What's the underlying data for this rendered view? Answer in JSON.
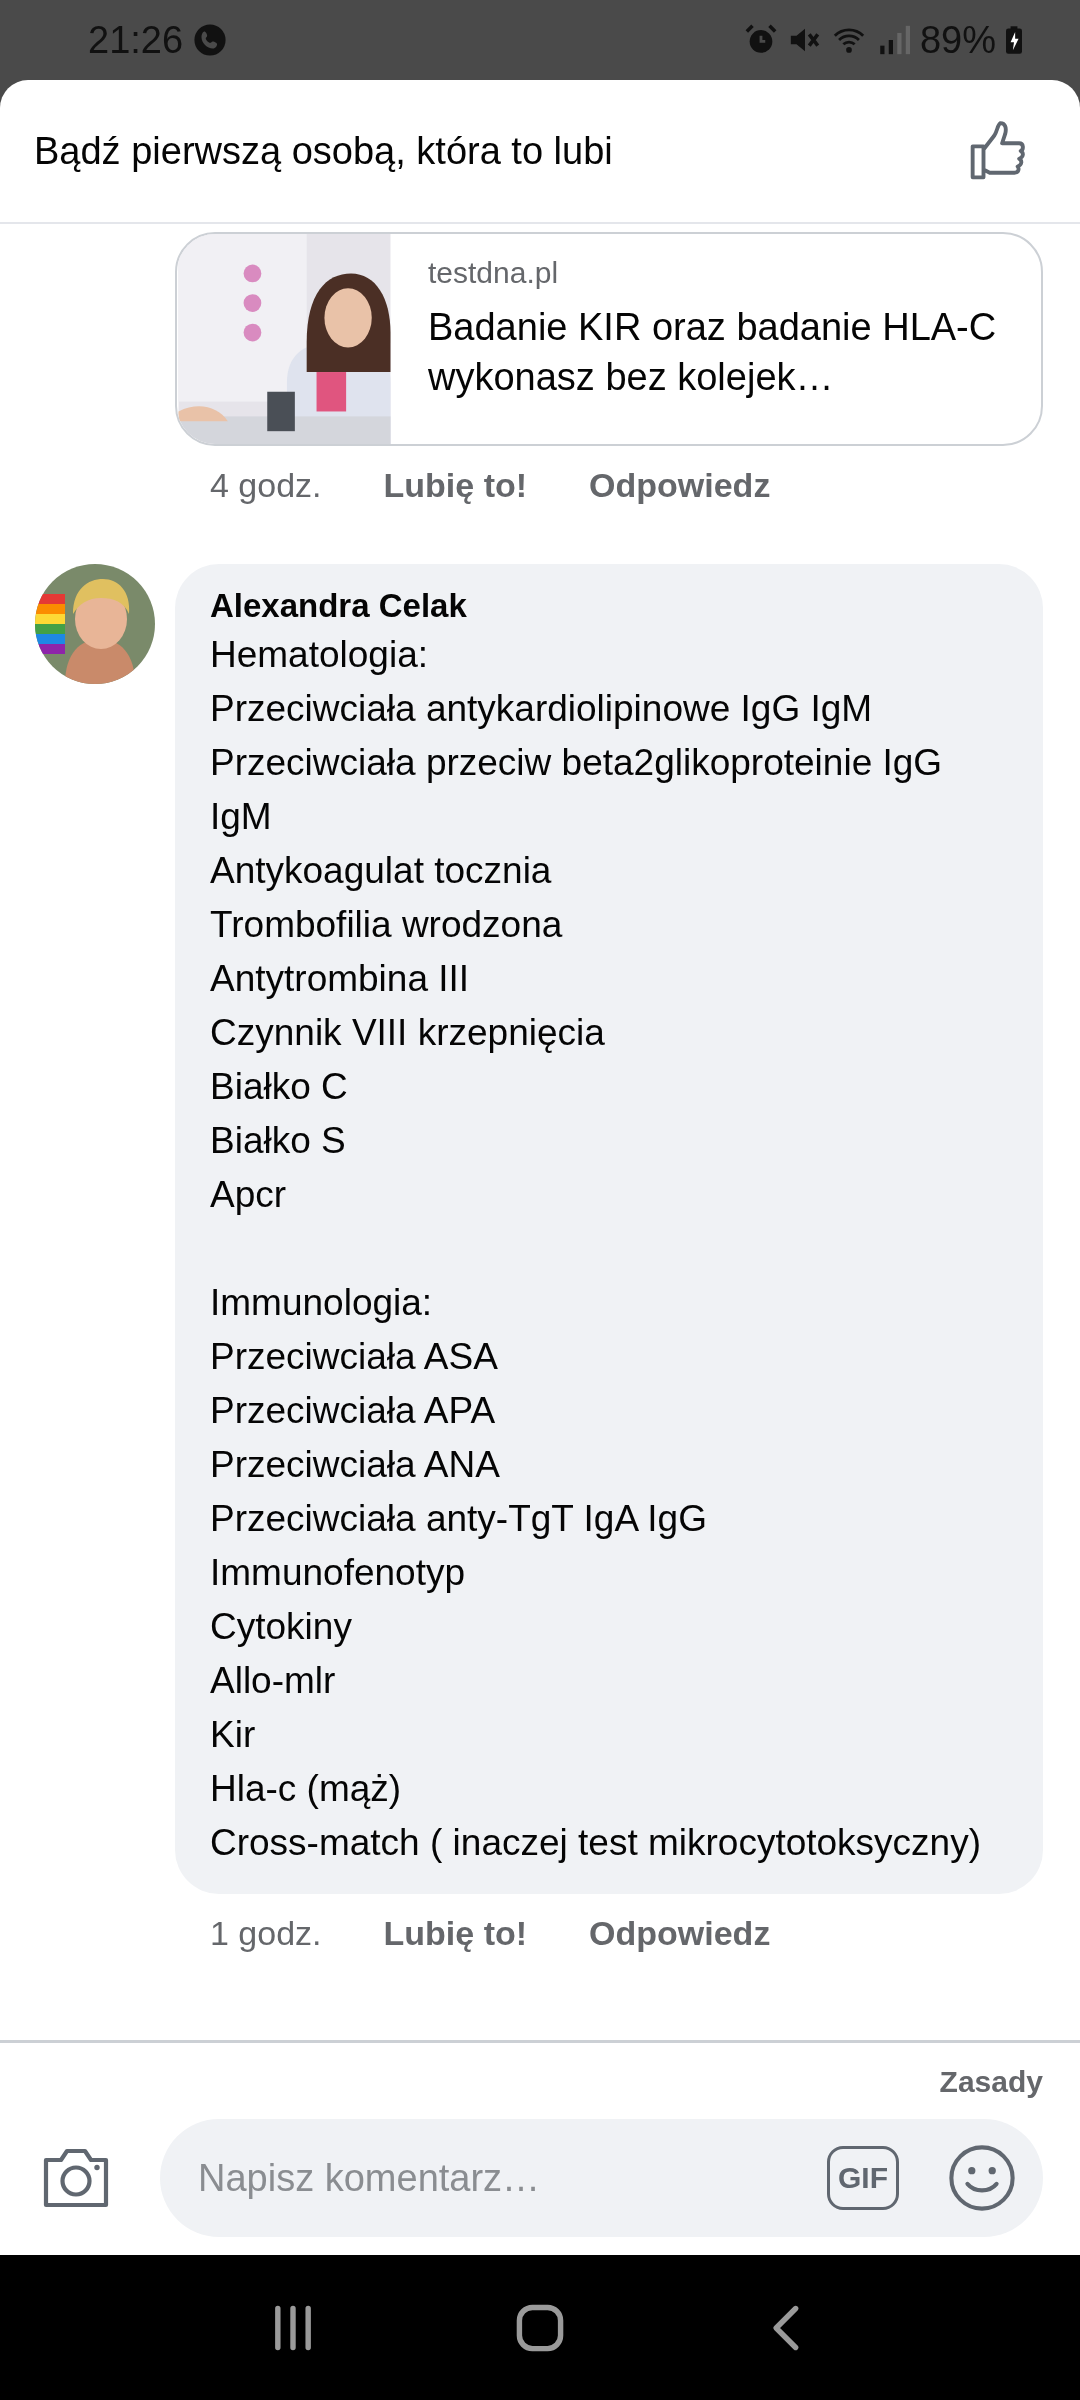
{
  "status_bar": {
    "time": "21:26",
    "battery": "89%"
  },
  "header": {
    "text": "Bądź pierwszą osobą, która to lubi"
  },
  "link_preview": {
    "kind": "picture",
    "domain": "testdna.pl",
    "title": "Badanie KIR oraz badanie HLA-C wykonasz bez kolejek…"
  },
  "link_meta": {
    "time": "4 godz.",
    "like": "Lubię to!",
    "reply": "Odpowiedz"
  },
  "comment": {
    "author": "Alexandra Celak",
    "paragraphs": [
      [
        "Hematologia:",
        "Przeciwciała antykardiolipinowe IgG IgM",
        "Przeciwciała przeciw beta2glikoproteinie IgG IgM",
        "Antykoagulat tocznia",
        "Trombofilia wrodzona",
        "Antytrombina III",
        "Czynnik VIII krzepnięcia",
        "Białko C",
        "Białko S",
        "Apcr"
      ],
      [
        "Immunologia:",
        "Przeciwciała ASA",
        "Przeciwciała APA",
        "Przeciwciała ANA",
        "Przeciwciała anty-TgT IgA IgG",
        "Immunofenotyp",
        "Cytokiny",
        "Allo-mlr",
        "Kir",
        "Hla-c (mąż)",
        "Cross-match ( inaczej test mikrocytotoksyczny)"
      ]
    ],
    "time": "1 godz.",
    "like": "Lubię to!",
    "reply": "Odpowiedz"
  },
  "rules_link": "Zasady",
  "composer": {
    "placeholder": "Napisz komentarz…",
    "gif": "GIF"
  }
}
